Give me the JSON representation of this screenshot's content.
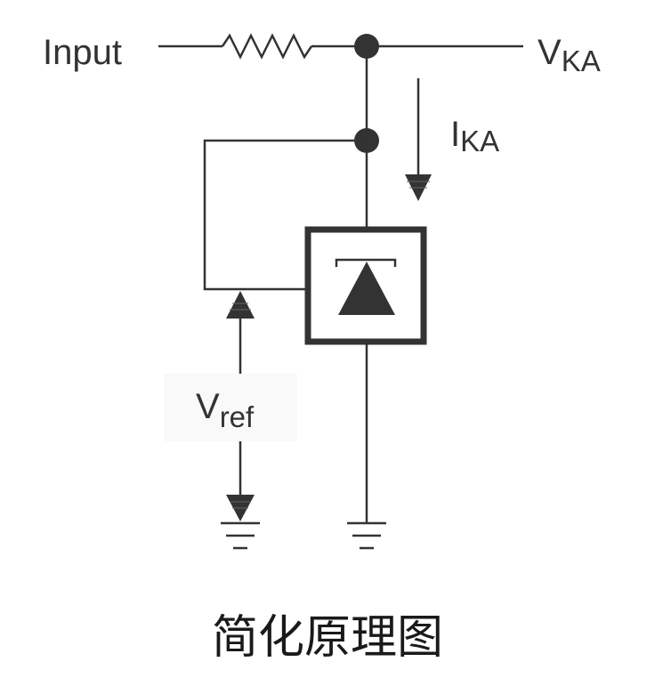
{
  "labels": {
    "input": "Input",
    "vka_main": "V",
    "vka_sub": "KA",
    "ika_main": "I",
    "ika_sub": "KA",
    "vref_main": "V",
    "vref_sub": "ref"
  },
  "caption": "简化原理图",
  "colors": {
    "wire": "#333333",
    "background": "#ffffff",
    "label_box": "#f9f9f9"
  }
}
